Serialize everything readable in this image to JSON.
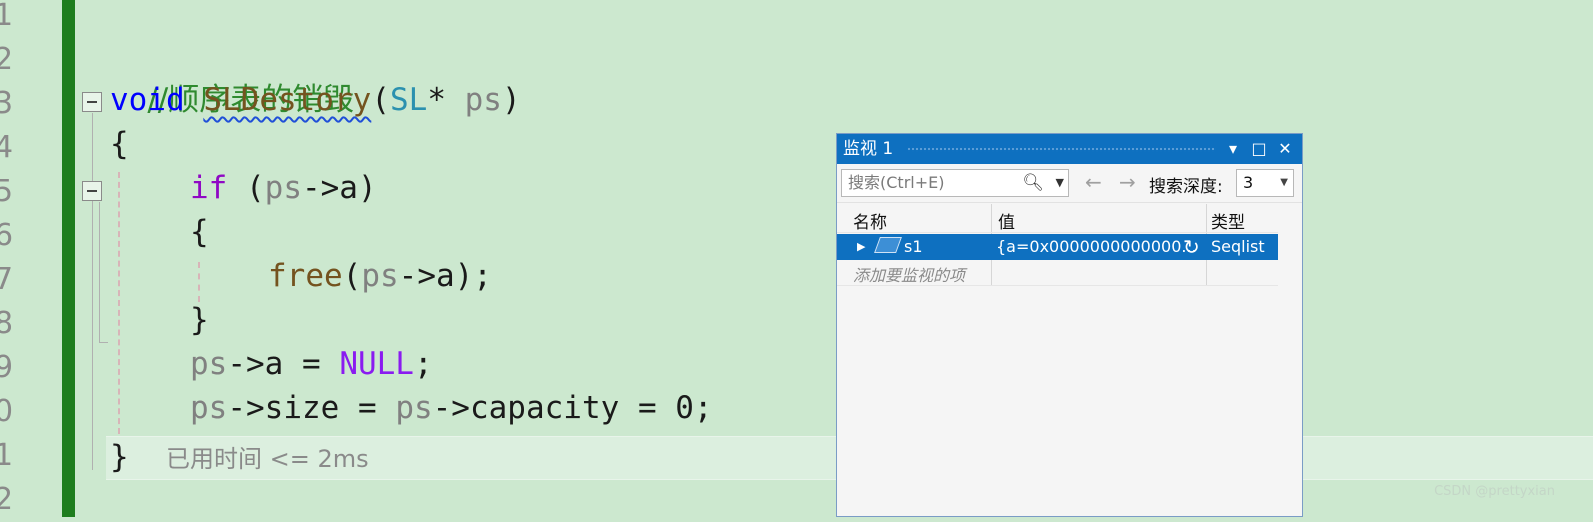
{
  "editor": {
    "line_numbers": [
      "1",
      "2",
      "3",
      "4",
      "5",
      "6",
      "7",
      "8",
      "9",
      "0",
      "1",
      "2"
    ],
    "comment": "//顺序表的销毁",
    "line3": {
      "kw": "void",
      "fn": "SLDestory",
      "open": "(",
      "type": "SL",
      "star": "* ",
      "param": "ps",
      "close": ")"
    },
    "brace_open": "{",
    "line5": {
      "kw": "if",
      "open": " (",
      "param": "ps",
      "rest": "->a)"
    },
    "inner_open": "{",
    "line7": {
      "fn": "free",
      "open": "(",
      "param": "ps",
      "rest": "->a);"
    },
    "inner_close": "}",
    "line9": {
      "param": "ps",
      "rest": "->a = ",
      "macro": "NULL",
      "end": ";"
    },
    "line10": {
      "param1": "ps",
      "mid": "->size = ",
      "param2": "ps",
      "rest": "->capacity = 0;"
    },
    "brace_close": "}",
    "elapsed_hint": "已用时间 <= 2ms"
  },
  "watch": {
    "title": "监视 1",
    "title_buttons": {
      "dropdown": "▾",
      "maximize": "□",
      "close": "✕"
    },
    "search_placeholder": "搜索(Ctrl+E)",
    "search_icon": "search-icon",
    "back_arrow": "←",
    "forward_arrow": "→",
    "depth_label": "搜索深度:",
    "depth_value": "3",
    "columns": {
      "name": "名称",
      "value": "值",
      "type": "类型"
    },
    "rows": [
      {
        "name": "s1",
        "value": "{a=0x0000000000000...",
        "type": "Seqlist"
      }
    ],
    "add_item": "添加要监视的项"
  },
  "watermark": "CSDN @prettyxian",
  "colors": {
    "editor_bg": "#cce8cf",
    "change_bar": "#1e7d1e",
    "accent": "#0e70c0"
  }
}
